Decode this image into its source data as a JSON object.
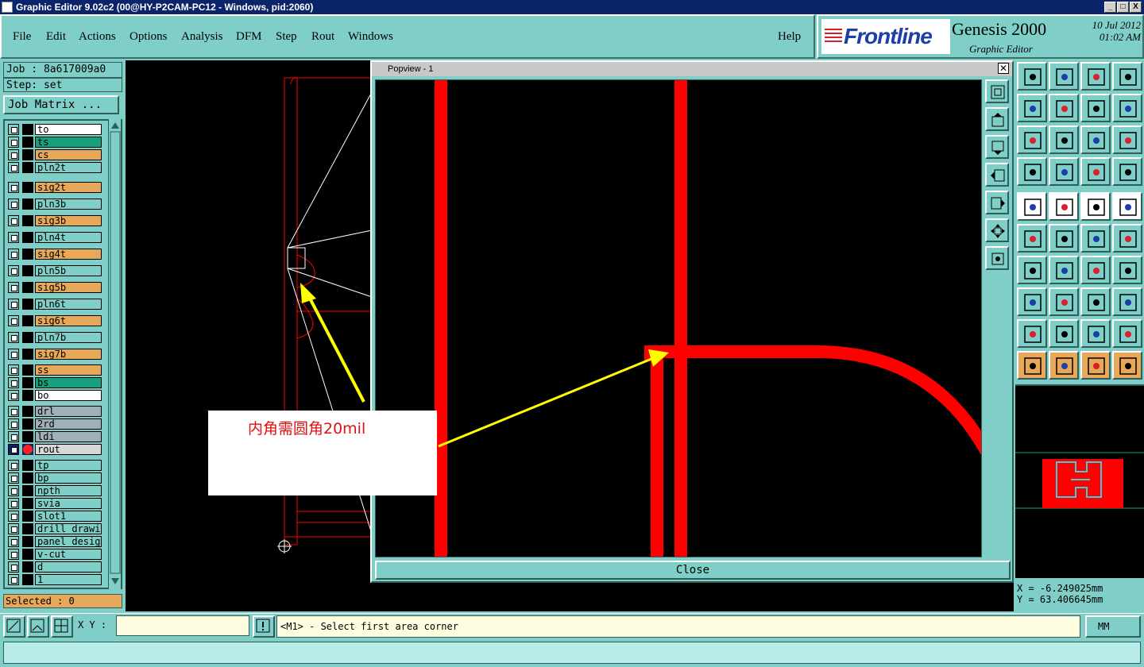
{
  "window": {
    "title": "Graphic Editor 9.02c2 (00@HY-P2CAM-PC12 - Windows, pid:2060)",
    "buttons": [
      "_",
      "□",
      "X"
    ]
  },
  "menu": [
    "File",
    "Edit",
    "Actions",
    "Options",
    "Analysis",
    "DFM",
    "Step",
    "Rout",
    "Windows"
  ],
  "help": "Help",
  "logo": {
    "brand": "Frontline",
    "product": "Genesis 2000",
    "subtitle": "Graphic Editor",
    "date": "10 Jul 2012",
    "time": "01:02 AM"
  },
  "job": {
    "job_label": "Job : 8a617009a0",
    "step_label": "Step: set",
    "matrix_button": "Job Matrix ..."
  },
  "layers": [
    {
      "name": "to",
      "color": "#ffffff"
    },
    {
      "name": "ts",
      "color": "#17a07c"
    },
    {
      "name": "cs",
      "color": "#e8a85a"
    },
    {
      "name": "pln2t",
      "color": "#7fcfc8"
    },
    {
      "name": "sig2t",
      "color": "#e8a85a"
    },
    {
      "name": "pln3b",
      "color": "#7fcfc8"
    },
    {
      "name": "sig3b",
      "color": "#e8a85a"
    },
    {
      "name": "pln4t",
      "color": "#7fcfc8"
    },
    {
      "name": "sig4t",
      "color": "#e8a85a"
    },
    {
      "name": "pln5b",
      "color": "#7fcfc8"
    },
    {
      "name": "sig5b",
      "color": "#e8a85a"
    },
    {
      "name": "pln6t",
      "color": "#7fcfc8"
    },
    {
      "name": "sig6t",
      "color": "#e8a85a"
    },
    {
      "name": "pln7b",
      "color": "#7fcfc8"
    },
    {
      "name": "sig7b",
      "color": "#e8a85a"
    },
    {
      "name": "ss",
      "color": "#e8a85a"
    },
    {
      "name": "bs",
      "color": "#17a07c"
    },
    {
      "name": "bo",
      "color": "#ffffff"
    },
    {
      "name": "drl",
      "color": "#a0b0b8"
    },
    {
      "name": "2rd",
      "color": "#a0b0b8"
    },
    {
      "name": "ldi",
      "color": "#a0b0b8"
    },
    {
      "name": "rout",
      "color": "#d8d8d8",
      "active": true
    },
    {
      "name": "tp",
      "color": "#7fcfc8"
    },
    {
      "name": "bp",
      "color": "#7fcfc8"
    },
    {
      "name": "npth",
      "color": "#7fcfc8"
    },
    {
      "name": "svia",
      "color": "#7fcfc8"
    },
    {
      "name": "slot1",
      "color": "#7fcfc8"
    },
    {
      "name": "drill_drawing",
      "color": "#7fcfc8"
    },
    {
      "name": "panel_design",
      "color": "#7fcfc8"
    },
    {
      "name": "v-cut",
      "color": "#7fcfc8"
    },
    {
      "name": "d",
      "color": "#7fcfc8"
    },
    {
      "name": "1",
      "color": "#7fcfc8"
    }
  ],
  "selected": "Selected : 0",
  "popview": {
    "title": "Popview - 1",
    "close_label": "Close"
  },
  "annotation": "内角需圆角20mil",
  "coords": {
    "x": "X = -6.249025mm",
    "y": "Y = 63.406645mm"
  },
  "bottom": {
    "xy_label": "X Y :",
    "prompt": "<M1> - Select first area corner",
    "units": "MM"
  },
  "colors": {
    "panel": "#7fcfc8",
    "rout": "#ff0000",
    "arrow": "#ffff00",
    "highlight": "#e8a85a"
  }
}
